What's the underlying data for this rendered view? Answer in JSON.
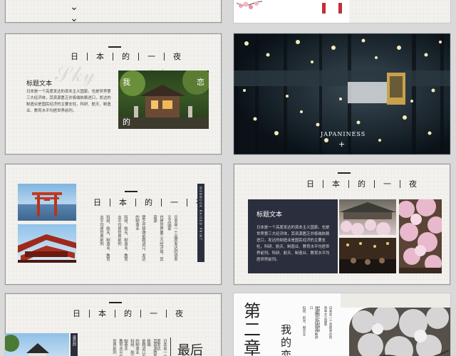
{
  "slides": {
    "top_left": {
      "chevron": "⌄⌄"
    },
    "s1": {
      "title_chars": [
        "日",
        "本",
        "的",
        "一",
        "夜"
      ],
      "heading": "标题文本",
      "body": "日本是一个高度发达的资本主义国家。也是世界第三大经济体，其资源匮乏并极端依赖进口，发达的制造业是国民经济的主要支柱，科研、航天、制造业、教育水平均居世界前列。",
      "overlay_left": "我",
      "overlay_right": "恋",
      "overlay_bottom": "的"
    },
    "s2": {
      "caption": "JAPANINESS",
      "plus": "+"
    },
    "s3": {
      "title_chars": [
        "日",
        "本",
        "的",
        "一",
        "夜"
      ],
      "cols": [
        "日本是一个高度发达的资本主义国家",
        "也是世界第三大经济体，其资源",
        "匮乏并极端依赖进口，发达的制造业",
        "科研、航天、制造业、教育水平均居世界前列",
        "科研、航天、制造业、教育水平均居世界前列"
      ],
      "side_label": "WEBBOOK RAISED PRINT"
    },
    "s4": {
      "title_chars": [
        "日",
        "本",
        "的",
        "一",
        "夜"
      ],
      "heading": "标题文本",
      "body": "日本是一个高度发达的资本主义国家。也是世界第三大经济体，其资源匮乏并极端依赖进口，发达的制造业是国民经济的主要支柱，科研、航天、制造业、教育水平均居世界前列。科研、航天、制造业、教育水平均居世界前列。"
    },
    "s5": {
      "title_chars": [
        "日",
        "本",
        "的",
        "一",
        "夜"
      ],
      "label": "最后的",
      "big": "最后",
      "cols": [
        "日本是一个高度发达",
        "其资源匮乏并极端",
        "依赖进口发达的制造业",
        "科研、航天、制造业",
        "教育水平均居世界前列"
      ]
    },
    "s6": {
      "chapter": "第二章",
      "sub": "我的恋",
      "cols": [
        "日本是一个高度发达的资本主义国家",
        "世界第三大经济体",
        "资源匮乏并极端依赖进口",
        "科研、航天、制造业"
      ]
    }
  },
  "colors": {
    "dark_panel": "#2b2f3d",
    "paper": "#f3f2ee"
  }
}
